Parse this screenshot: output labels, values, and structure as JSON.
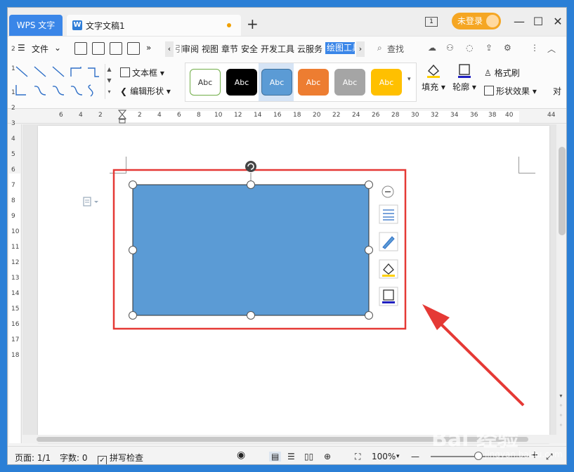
{
  "titlebar": {
    "app_tab": "WPS 文字",
    "doc_tab": "文字文稿1",
    "doc_icon_letter": "W",
    "add_tab": "+",
    "book_icon_text": "1",
    "login_label": "未登录",
    "min": "—",
    "max": "☐",
    "close": "✕"
  },
  "menubar": {
    "file_label": "文件",
    "more": "»",
    "left_arrow": "‹",
    "right_arrow": "›",
    "items": [
      "审阅",
      "视图",
      "章节",
      "安全",
      "开发工具",
      "云服务"
    ],
    "active_item": "绘图工具",
    "search_label": "查找",
    "first_partial": "引"
  },
  "ribbon": {
    "textbox_label": "文本框",
    "edit_shape_label": "编辑形状",
    "styles": [
      {
        "label": "Abc",
        "bg": "#ffffff",
        "fg": "#333333",
        "border": "#70ad47"
      },
      {
        "label": "Abc",
        "bg": "#000000",
        "fg": "#ffffff",
        "border": "#000000"
      },
      {
        "label": "Abc",
        "bg": "#5b9bd5",
        "fg": "#ffffff",
        "border": "#41719c"
      },
      {
        "label": "Abc",
        "bg": "#ed7d31",
        "fg": "#ffffff",
        "border": "#ed7d31"
      },
      {
        "label": "Abc",
        "bg": "#a5a5a5",
        "fg": "#ffffff",
        "border": "#a5a5a5"
      },
      {
        "label": "Abc",
        "bg": "#ffc000",
        "fg": "#ffffff",
        "border": "#ffc000"
      }
    ],
    "fill_label": "填充",
    "outline_label": "轮廓",
    "format_painter_label": "格式刷",
    "shape_effect_label": "形状效果",
    "partial_label": "对"
  },
  "ruler": {
    "h_numbers": [
      "6",
      "4",
      "2",
      "2",
      "4",
      "6",
      "8",
      "10",
      "12",
      "14",
      "16",
      "18",
      "20",
      "22",
      "24",
      "26",
      "28",
      "30",
      "32",
      "34",
      "36",
      "38",
      "40",
      "44"
    ],
    "v_numbers": [
      "2",
      "1",
      "1",
      "2",
      "3",
      "4",
      "5",
      "6",
      "7",
      "8",
      "9",
      "10",
      "11",
      "12",
      "13",
      "14",
      "15",
      "16",
      "17",
      "18"
    ]
  },
  "shape": {
    "fill": "#5b9bd5",
    "stroke": "#2f2f2f",
    "highlight_box": "#e53935"
  },
  "statusbar": {
    "page": "页面: 1/1",
    "words": "字数: 0",
    "spell": "拼写检查",
    "zoom": "100%",
    "zoom_minus": "—",
    "zoom_plus": "+"
  },
  "watermark": {
    "brand": "Bai  经验",
    "sub": "jingyan.baidu.com"
  }
}
